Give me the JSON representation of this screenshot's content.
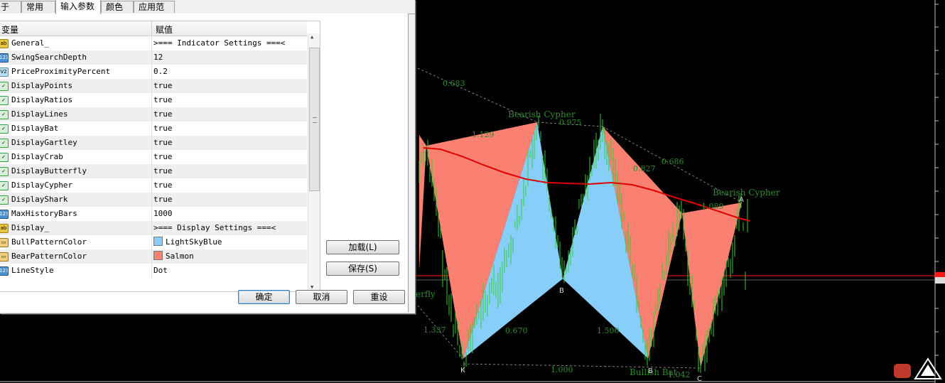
{
  "tabs": [
    "于",
    "常用",
    "输入参数",
    "颜色",
    "应用范围"
  ],
  "active_tab": "输入参数",
  "grid": {
    "col_variable": "变量",
    "col_value": "赋值",
    "rows": [
      {
        "icon": "ab-icon",
        "icon_text": "ab",
        "name": "General_",
        "value": ">=== Indicator Settings ===<"
      },
      {
        "icon": "int-icon",
        "icon_text": "123",
        "name": "SwingSearchDepth",
        "value": "12"
      },
      {
        "icon": "double-icon",
        "icon_text": "V2",
        "name": "PriceProximityPercent",
        "value": "0.2"
      },
      {
        "icon": "bool-icon",
        "icon_text": "✓",
        "name": "DisplayPoints",
        "value": "true"
      },
      {
        "icon": "bool-icon",
        "icon_text": "✓",
        "name": "DisplayRatios",
        "value": "true"
      },
      {
        "icon": "bool-icon",
        "icon_text": "✓",
        "name": "DisplayLines",
        "value": "true"
      },
      {
        "icon": "bool-icon",
        "icon_text": "✓",
        "name": "DisplayBat",
        "value": "true"
      },
      {
        "icon": "bool-icon",
        "icon_text": "✓",
        "name": "DisplayGartley",
        "value": "true"
      },
      {
        "icon": "bool-icon",
        "icon_text": "✓",
        "name": "DisplayCrab",
        "value": "true"
      },
      {
        "icon": "bool-icon",
        "icon_text": "✓",
        "name": "DisplayButterfly",
        "value": "true"
      },
      {
        "icon": "bool-icon",
        "icon_text": "✓",
        "name": "DisplayCypher",
        "value": "true"
      },
      {
        "icon": "bool-icon",
        "icon_text": "✓",
        "name": "DisplayShark",
        "value": "true"
      },
      {
        "icon": "int-icon",
        "icon_text": "123",
        "name": "MaxHistoryBars",
        "value": "1000"
      },
      {
        "icon": "ab-icon",
        "icon_text": "ab",
        "name": "Display_",
        "value": ">=== Display Settings ===<"
      },
      {
        "icon": "color-icon",
        "icon_text": "▭",
        "name": "BullPatternColor",
        "value": "LightSkyBlue",
        "swatch": "#87cefa"
      },
      {
        "icon": "color-icon",
        "icon_text": "▭",
        "name": "BearPatternColor",
        "value": "Salmon",
        "swatch": "#fa8072"
      },
      {
        "icon": "int-icon",
        "icon_text": "123",
        "name": "LineStyle",
        "value": "Dot"
      }
    ]
  },
  "buttons": {
    "load": "加载(L)",
    "save": "保存(S)",
    "ok": "确定",
    "cancel": "取消",
    "reset": "重设"
  },
  "chart": {
    "bull_color": "#87cefa",
    "bear_color": "#fa8072",
    "ma_color": "#e00000",
    "candle_color": "#32cd32",
    "label_color": "#2e8b2e",
    "labels": {
      "bearish_cypher_1": "Bearish Cypher",
      "bearish_cypher_2": "Bearish Cypher",
      "bullish_bat": "Bullish Bat",
      "butterfly_frag": "erfly"
    },
    "ratios": [
      "0.683",
      "1.129",
      "0.975",
      "0.827",
      "0.686",
      "1.089",
      "1.337",
      "0.670",
      "1.500",
      "1.000",
      "1.042"
    ],
    "points": [
      "K",
      "B",
      "B",
      "C",
      "A"
    ]
  }
}
